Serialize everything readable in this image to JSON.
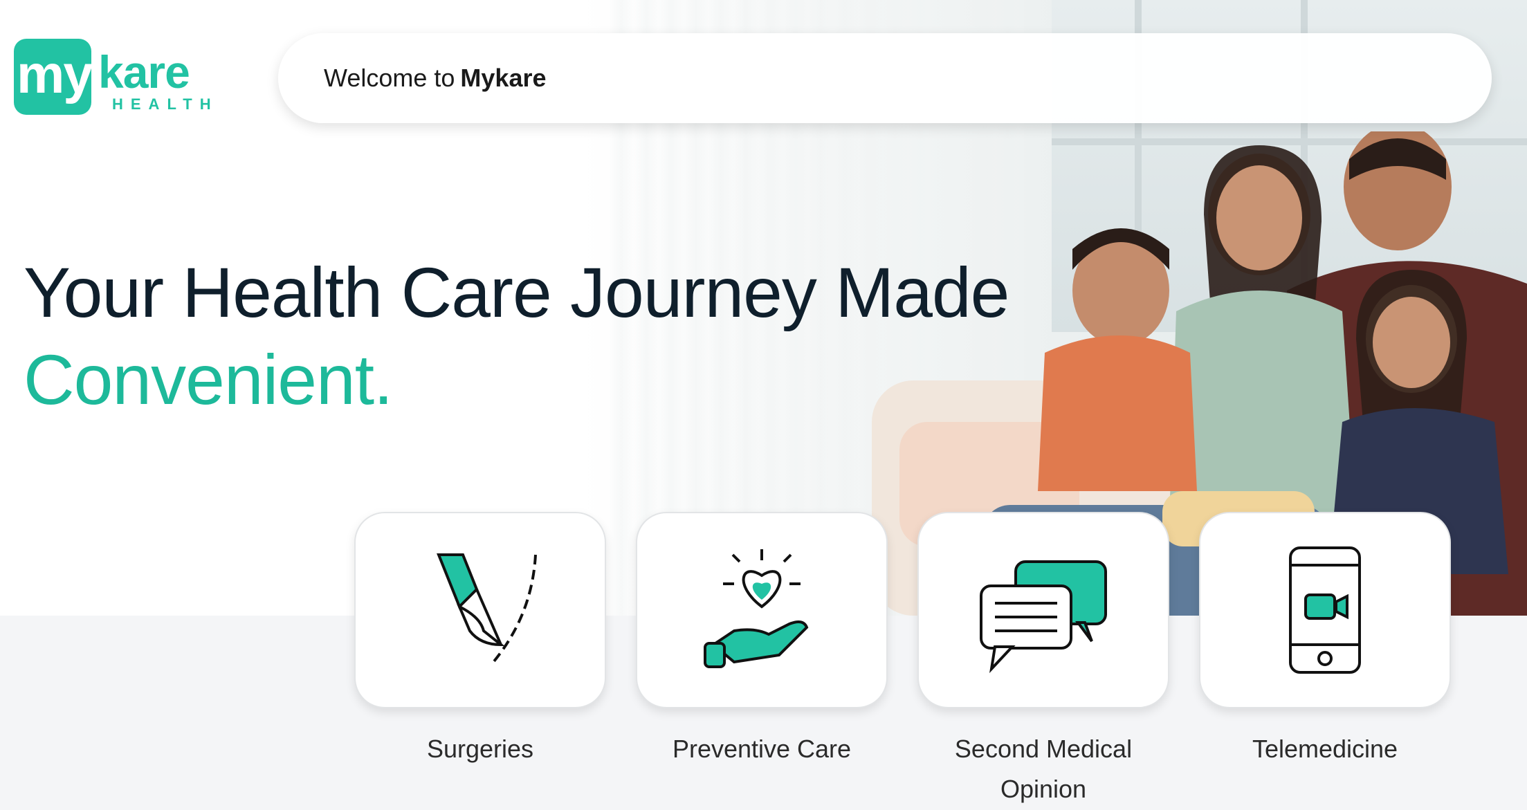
{
  "brand": {
    "logo_badge_text": "my",
    "logo_main": "kare",
    "logo_sub": "HEALTH",
    "accent_color": "#22c2a3",
    "heading_color": "#0f1f2c"
  },
  "welcome": {
    "prefix": "Welcome to",
    "brand": "Mykare"
  },
  "hero": {
    "line1": "Your Health Care Journey Made",
    "line2": "Convenient."
  },
  "services": [
    {
      "label": "Surgeries",
      "icon": "scalpel-icon"
    },
    {
      "label": "Preventive Care",
      "icon": "heart-hand-icon"
    },
    {
      "label": "Second Medical Opinion",
      "icon": "chat-bubbles-icon"
    },
    {
      "label": "Telemedicine",
      "icon": "phone-video-icon"
    }
  ]
}
